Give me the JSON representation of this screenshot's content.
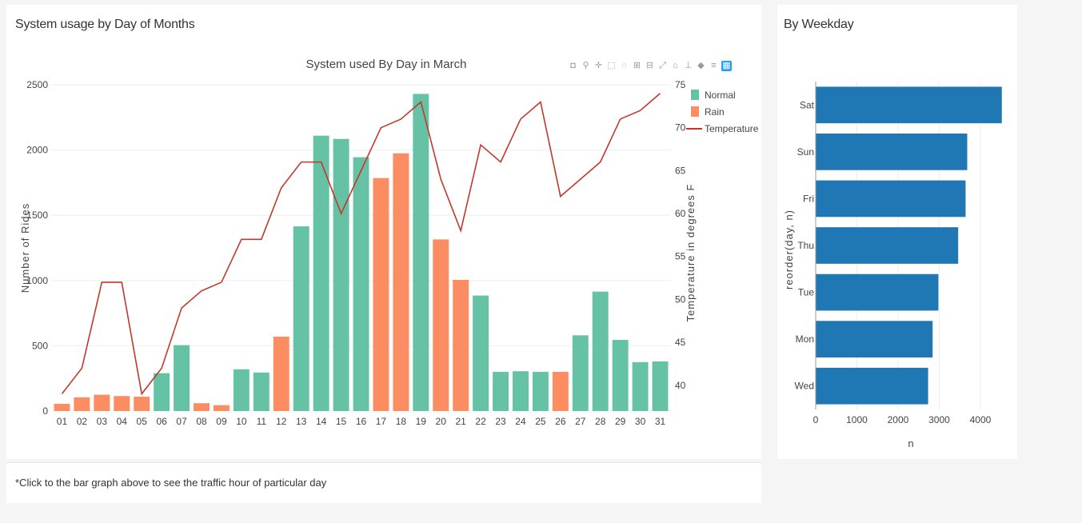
{
  "main_panel": {
    "title": "System usage by Day of Months"
  },
  "side_panel": {
    "title": "By Weekday"
  },
  "note": {
    "text": "*Click to the bar graph above to see the traffic hour of particular day"
  },
  "modebar": {
    "icons": [
      "camera-icon",
      "zoom-icon",
      "pan-icon",
      "box-select-icon",
      "lasso-icon",
      "zoom-in-icon",
      "zoom-out-icon",
      "autoscale-icon",
      "reset-axes-icon",
      "spike-lines-icon",
      "hover-closest-icon",
      "hover-compare-icon",
      "plotly-logo-icon"
    ]
  },
  "colors": {
    "normal": "#66c2a5",
    "rain": "#fc8d62",
    "temperature": "#c0392b",
    "weekday_bar": "#1f77b4"
  },
  "chart_data": [
    {
      "type": "bar",
      "title": "System used By Day in March",
      "xlabel": "",
      "ylabel": "Number of Rides",
      "y2label": "Temperature in degrees F",
      "ylim": [
        0,
        2500
      ],
      "y2lim": [
        37,
        75
      ],
      "yticks": [
        "0",
        "500",
        "1000",
        "1500",
        "2000",
        "2500"
      ],
      "y2ticks": [
        "40",
        "45",
        "50",
        "55",
        "60",
        "65",
        "70",
        "75"
      ],
      "legend_position": "top-right",
      "categories": [
        "01",
        "02",
        "03",
        "04",
        "05",
        "06",
        "07",
        "08",
        "09",
        "10",
        "11",
        "12",
        "13",
        "14",
        "15",
        "16",
        "17",
        "18",
        "19",
        "20",
        "21",
        "22",
        "23",
        "24",
        "25",
        "26",
        "27",
        "28",
        "29",
        "30",
        "31"
      ],
      "series": [
        {
          "name": "Normal",
          "type": "bar",
          "points": [
            {
              "x": "06",
              "y": 290
            },
            {
              "x": "07",
              "y": 505
            },
            {
              "x": "10",
              "y": 320
            },
            {
              "x": "11",
              "y": 295
            },
            {
              "x": "13",
              "y": 1415
            },
            {
              "x": "14",
              "y": 2110
            },
            {
              "x": "15",
              "y": 2085
            },
            {
              "x": "16",
              "y": 1945
            },
            {
              "x": "19",
              "y": 2430
            },
            {
              "x": "22",
              "y": 885
            },
            {
              "x": "23",
              "y": 300
            },
            {
              "x": "24",
              "y": 305
            },
            {
              "x": "25",
              "y": 300
            },
            {
              "x": "27",
              "y": 580
            },
            {
              "x": "28",
              "y": 915
            },
            {
              "x": "29",
              "y": 545
            },
            {
              "x": "30",
              "y": 375
            },
            {
              "x": "31",
              "y": 380
            }
          ]
        },
        {
          "name": "Rain",
          "type": "bar",
          "points": [
            {
              "x": "01",
              "y": 55
            },
            {
              "x": "02",
              "y": 105
            },
            {
              "x": "03",
              "y": 125
            },
            {
              "x": "04",
              "y": 115
            },
            {
              "x": "05",
              "y": 110
            },
            {
              "x": "08",
              "y": 60
            },
            {
              "x": "09",
              "y": 45
            },
            {
              "x": "12",
              "y": 570
            },
            {
              "x": "17",
              "y": 1785
            },
            {
              "x": "18",
              "y": 1975
            },
            {
              "x": "20",
              "y": 1315
            },
            {
              "x": "21",
              "y": 1005
            },
            {
              "x": "26",
              "y": 300
            }
          ]
        },
        {
          "name": "Temperature",
          "type": "line",
          "axis": "y2",
          "values": [
            39,
            42,
            52,
            52,
            39,
            42,
            49,
            51,
            52,
            57,
            57,
            63,
            66,
            66,
            60,
            65,
            70,
            71,
            73,
            64,
            58,
            68,
            66,
            71,
            73,
            62,
            64,
            66,
            71,
            72,
            74
          ]
        }
      ]
    },
    {
      "type": "bar",
      "orientation": "horizontal",
      "title": "",
      "xlabel": "n",
      "ylabel": "reorder(day, n)",
      "xlim": [
        0,
        4700
      ],
      "xticks": [
        "0",
        "1000",
        "2000",
        "3000",
        "4000"
      ],
      "categories": [
        "Sat",
        "Sun",
        "Fri",
        "Thu",
        "Tue",
        "Mon",
        "Wed"
      ],
      "values": [
        4520,
        3680,
        3640,
        3460,
        2980,
        2840,
        2730
      ]
    }
  ]
}
